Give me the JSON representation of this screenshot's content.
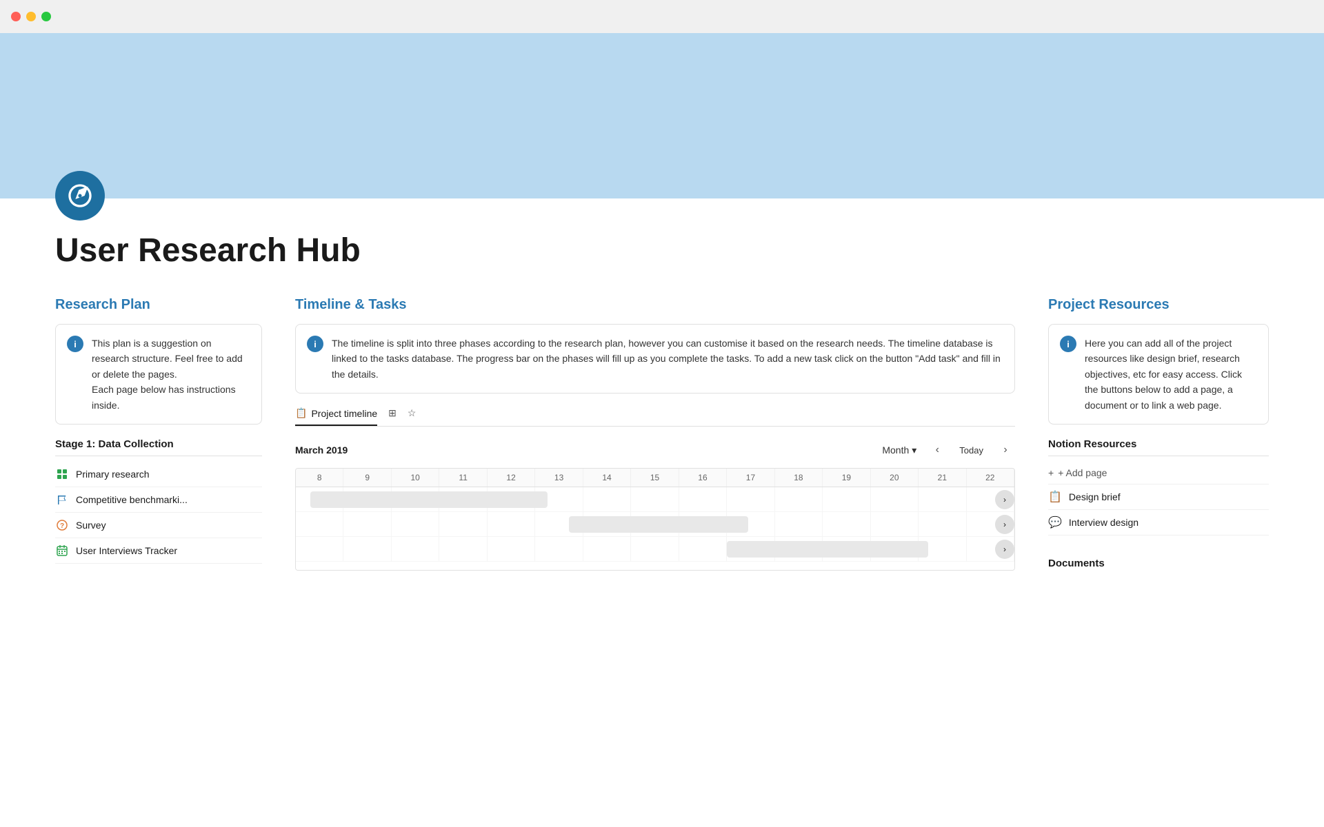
{
  "titleBar": {
    "trafficLights": [
      "red",
      "yellow",
      "green"
    ]
  },
  "hero": {
    "backgroundColor": "#b8d9f0"
  },
  "pageIcon": {
    "symbol": "compass"
  },
  "pageTitle": "User Research Hub",
  "researchPlan": {
    "sectionTitle": "Research Plan",
    "infoBox": {
      "text": "This plan is a suggestion on research structure. Feel free to add or delete the pages.\nEach page below has instructions inside."
    },
    "stageHeading": "Stage 1: Data Collection",
    "listItems": [
      {
        "label": "Primary research",
        "iconType": "grid-green"
      },
      {
        "label": "Competitive benchmarki...",
        "iconType": "flag-teal"
      },
      {
        "label": "Survey",
        "iconType": "question-orange"
      },
      {
        "label": "User Interviews Tracker",
        "iconType": "calendar-green"
      }
    ]
  },
  "timeline": {
    "sectionTitle": "Timeline & Tasks",
    "infoBox": {
      "text": "The timeline is split into three phases according to the research plan, however you can customise it based on the research needs. The timeline database is linked to the tasks database. The progress bar on the phases will fill up as you complete the tasks. To add a new task click on the button \"Add task\" and fill in the details."
    },
    "tabs": [
      {
        "label": "Project timeline",
        "icon": "📋",
        "active": true
      },
      {
        "label": "",
        "icon": "⊞",
        "active": false
      },
      {
        "label": "",
        "icon": "☆",
        "active": false
      }
    ],
    "currentDate": "March 2019",
    "monthLabel": "Month",
    "todayLabel": "Today",
    "dates": [
      "8",
      "9",
      "10",
      "11",
      "12",
      "13",
      "14",
      "15",
      "16",
      "17",
      "18",
      "19",
      "20",
      "21",
      "22"
    ],
    "rows": [
      {
        "blockStart": 0,
        "blockWidth": 35
      },
      {
        "blockStart": 35,
        "blockWidth": 30
      },
      {
        "blockStart": 60,
        "blockWidth": 25
      }
    ]
  },
  "resources": {
    "sectionTitle": "Project Resources",
    "infoBox": {
      "text": "Here you can add all of the project resources like design brief, research objectives, etc for easy access. Click the buttons below to add a page, a document or to link a web page."
    },
    "notionResourcesTitle": "Notion Resources",
    "addPageLabel": "+ Add page",
    "links": [
      {
        "label": "Design brief",
        "icon": "📋"
      },
      {
        "label": "Interview design",
        "icon": "💬"
      }
    ],
    "documentsTitle": "Documents"
  }
}
